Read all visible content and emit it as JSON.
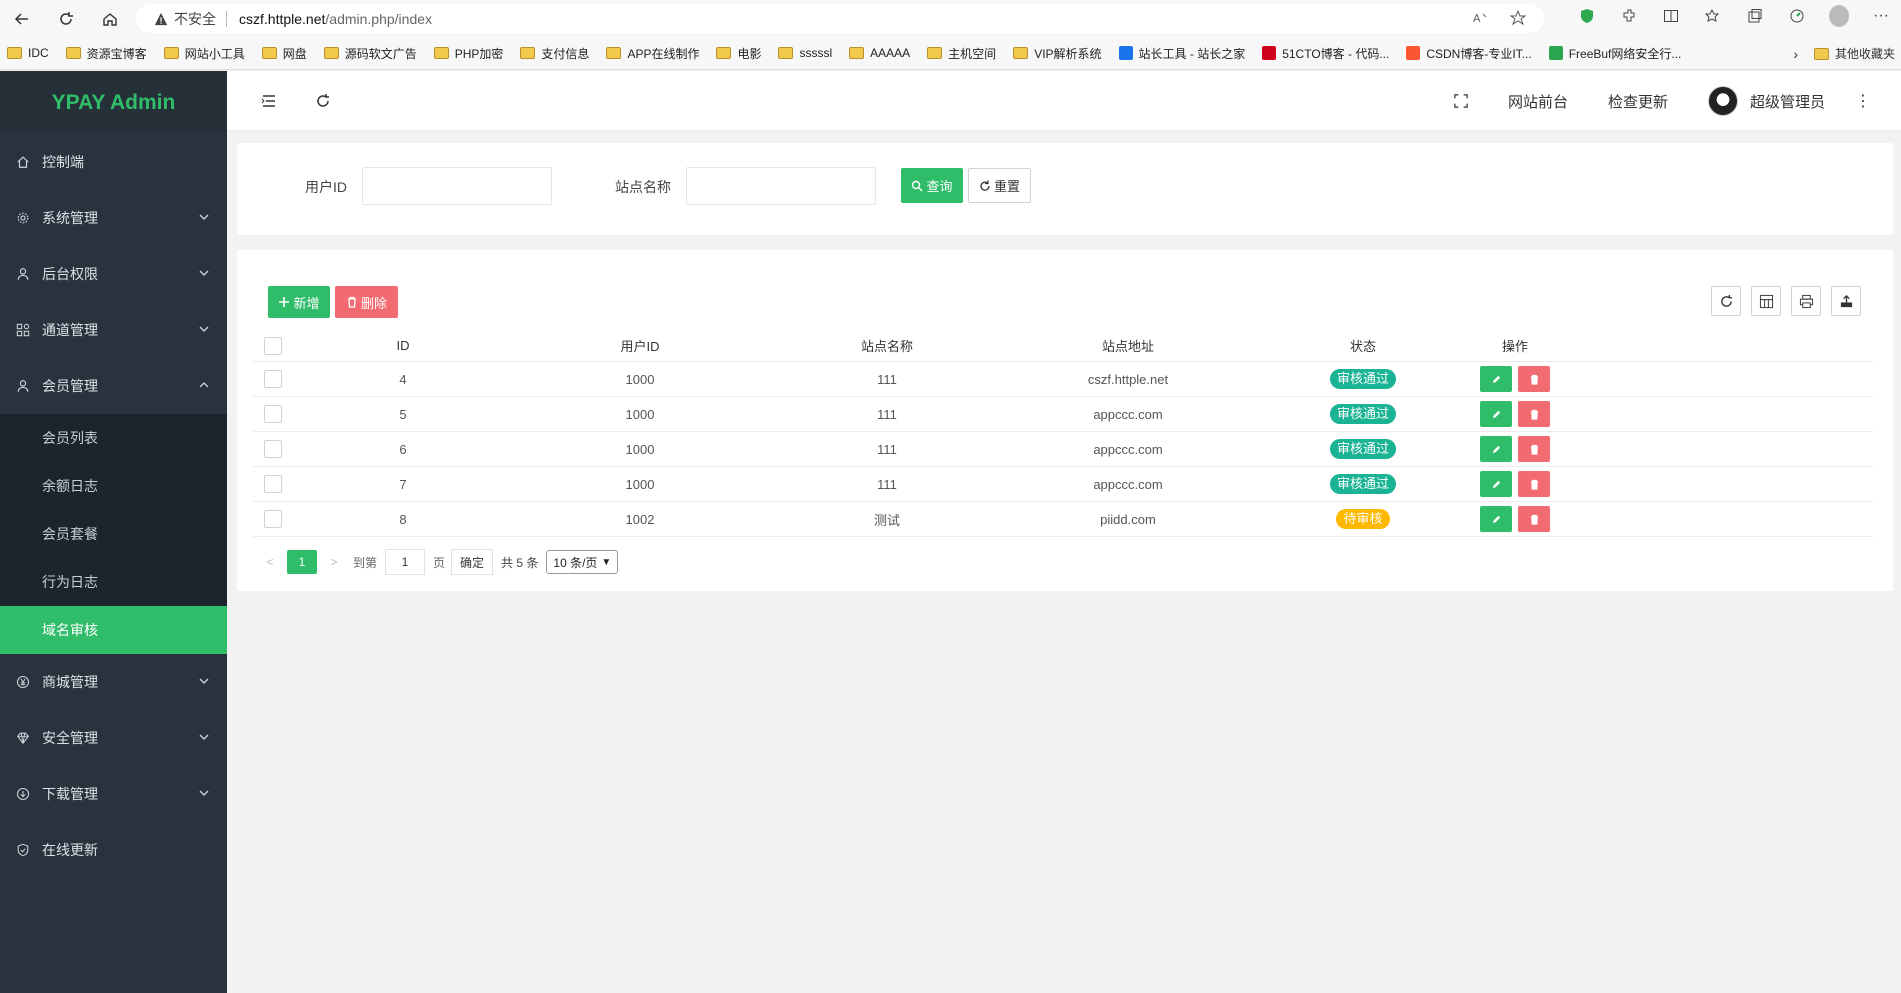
{
  "browser": {
    "insecure_label": "不安全",
    "url_host": "cszf.httple.net",
    "url_path": "/admin.php/index",
    "bookmarks": [
      {
        "label": "IDC",
        "type": "folder"
      },
      {
        "label": "资源宝博客",
        "type": "folder"
      },
      {
        "label": "网站小工具",
        "type": "folder"
      },
      {
        "label": "网盘",
        "type": "folder"
      },
      {
        "label": "源码软文广告",
        "type": "folder"
      },
      {
        "label": "PHP加密",
        "type": "folder"
      },
      {
        "label": "支付信息",
        "type": "folder"
      },
      {
        "label": "APP在线制作",
        "type": "folder"
      },
      {
        "label": "电影",
        "type": "folder"
      },
      {
        "label": "sssssl",
        "type": "folder"
      },
      {
        "label": "AAAAA",
        "type": "folder"
      },
      {
        "label": "主机空间",
        "type": "folder"
      },
      {
        "label": "VIP解析系统",
        "type": "folder"
      },
      {
        "label": "站长工具 - 站长之家",
        "type": "site",
        "color": "#1a73e8"
      },
      {
        "label": "51CTO博客 - 代码...",
        "type": "site",
        "color": "#d0021b"
      },
      {
        "label": "CSDN博客-专业IT...",
        "type": "site",
        "color": "#fc5531"
      },
      {
        "label": "FreeBuf网络安全行...",
        "type": "site",
        "color": "#2ca550"
      }
    ],
    "other_bookmarks": "其他收藏夹"
  },
  "sidebar": {
    "logo": "YPAY Admin",
    "items": [
      {
        "label": "控制端",
        "icon": "home-icon",
        "has_children": false
      },
      {
        "label": "系统管理",
        "icon": "gear-icon",
        "has_children": true
      },
      {
        "label": "后台权限",
        "icon": "user-icon",
        "has_children": true
      },
      {
        "label": "通道管理",
        "icon": "apps-icon",
        "has_children": true
      },
      {
        "label": "会员管理",
        "icon": "user-icon",
        "has_children": true,
        "expanded": true
      }
    ],
    "submenu": [
      {
        "label": "会员列表",
        "active": false
      },
      {
        "label": "余额日志",
        "active": false
      },
      {
        "label": "会员套餐",
        "active": false
      },
      {
        "label": "行为日志",
        "active": false
      },
      {
        "label": "域名审核",
        "active": true
      }
    ],
    "items_after": [
      {
        "label": "商城管理",
        "icon": "yen-icon",
        "has_children": true
      },
      {
        "label": "安全管理",
        "icon": "diamond-icon",
        "has_children": true
      },
      {
        "label": "下载管理",
        "icon": "download-icon",
        "has_children": true
      },
      {
        "label": "在线更新",
        "icon": "shield-icon",
        "has_children": false
      }
    ]
  },
  "header": {
    "site_front": "网站前台",
    "check_update": "检查更新",
    "username": "超级管理员"
  },
  "search": {
    "user_id_label": "用户ID",
    "site_name_label": "站点名称",
    "query_button": "查询",
    "reset_button": "重置"
  },
  "toolbar": {
    "add_button": "新增",
    "delete_button": "删除"
  },
  "table": {
    "columns": [
      "ID",
      "用户ID",
      "站点名称",
      "站点地址",
      "状态",
      "操作"
    ],
    "rows": [
      {
        "id": "4",
        "user_id": "1000",
        "site_name": "111",
        "site_url": "cszf.httple.net",
        "status": "审核通过",
        "status_color": "#1ab394"
      },
      {
        "id": "5",
        "user_id": "1000",
        "site_name": "111",
        "site_url": "appccc.com",
        "status": "审核通过",
        "status_color": "#1ab394"
      },
      {
        "id": "6",
        "user_id": "1000",
        "site_name": "111",
        "site_url": "appccc.com",
        "status": "审核通过",
        "status_color": "#1ab394"
      },
      {
        "id": "7",
        "user_id": "1000",
        "site_name": "111",
        "site_url": "appccc.com",
        "status": "审核通过",
        "status_color": "#1ab394"
      },
      {
        "id": "8",
        "user_id": "1002",
        "site_name": "测试",
        "site_url": "piidd.com",
        "status": "待审核",
        "status_color": "#ffb800"
      }
    ]
  },
  "pager": {
    "current_page": "1",
    "goto_label": "到第",
    "page_input": "1",
    "page_unit": "页",
    "confirm": "确定",
    "total": "共 5 条",
    "page_size": "10 条/页"
  },
  "colors": {
    "accent": "#2fbd6a",
    "danger": "#f26b70",
    "sidebar_bg": "#28333e"
  }
}
